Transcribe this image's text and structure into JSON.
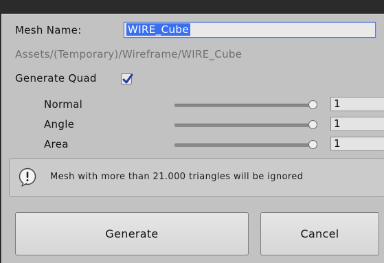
{
  "mesh_name": {
    "label": "Mesh Name:",
    "value": "WIRE_Cube"
  },
  "asset_path": "Assets/(Temporary)/Wireframe/WIRE_Cube",
  "generate_quad": {
    "label": "Generate Quad",
    "checked": true
  },
  "sliders": [
    {
      "label": "Normal",
      "value": "1",
      "fraction": 1.0
    },
    {
      "label": "Angle",
      "value": "1",
      "fraction": 1.0
    },
    {
      "label": "Area",
      "value": "1",
      "fraction": 1.0
    }
  ],
  "help": {
    "icon": "info-icon",
    "text": "Mesh with more than 21.000 triangles will be ignored"
  },
  "buttons": {
    "generate": "Generate",
    "cancel": "Cancel"
  },
  "colors": {
    "selection": "#3a6ff0",
    "panel": "#c2c2c2",
    "focus_border": "#5b7bd4"
  }
}
